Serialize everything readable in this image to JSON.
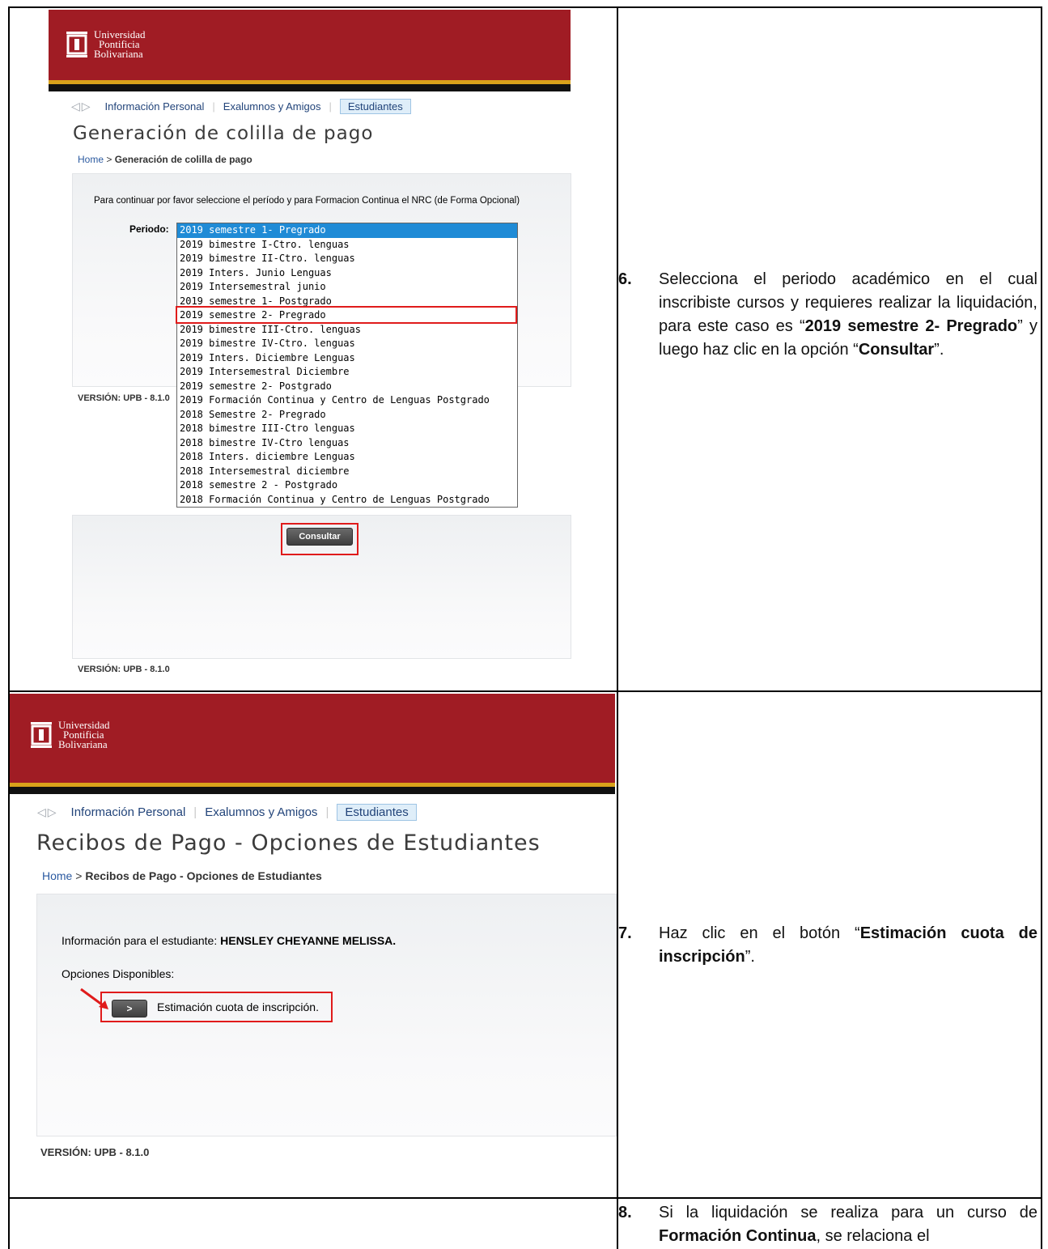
{
  "row1": {
    "brand": {
      "line1": "Universidad",
      "line2": "Pontificia",
      "line3": "Bolivariana"
    },
    "nav": {
      "tab1": "Información Personal",
      "tab2": "Exalumnos y Amigos",
      "tab3": "Estudiantes"
    },
    "page_title": "Generación de colilla de pago",
    "breadcrumb": {
      "home": "Home",
      "sep": ">",
      "current": "Generación de colilla de pago"
    },
    "instruction": "Para continuar por favor seleccione el período y para Formacion Continua el NRC (de Forma Opcional)",
    "periodo_label": "Periodo:",
    "periods": [
      "2019 semestre 1- Pregrado",
      "2019 bimestre I-Ctro. lenguas",
      "2019 bimestre II-Ctro. lenguas",
      "2019 Inters. Junio Lenguas",
      "2019 Intersemestral junio",
      "2019 semestre 1- Postgrado",
      "2019 semestre 2- Pregrado",
      "2019 bimestre III-Ctro. lenguas",
      "2019 bimestre IV-Ctro. lenguas",
      "2019 Inters. Diciembre Lenguas",
      "2019 Intersemestral Diciembre",
      "2019 semestre 2- Postgrado",
      "2019 Formación Continua y Centro de Lenguas Postgrado",
      "2018 Semestre 2- Pregrado",
      "2018 bimestre III-Ctro lenguas",
      "2018 bimestre IV-Ctro lenguas",
      "2018 Inters. diciembre Lenguas",
      "2018 Intersemestral diciembre",
      "2018 semestre 2 - Postgrado",
      "2018 Formación Continua y Centro de Lenguas Postgrado"
    ],
    "version_hidden": "VERSIÓN: UPB - 8.1.0",
    "consultar": "Consultar",
    "version": "VERSIÓN: UPB - 8.1.0",
    "step_num": "6.",
    "step_a": "Selecciona el periodo académico en el cual inscribiste cursos y requieres realizar la liquidación, para este caso es “",
    "step_b": "2019 semestre 2- Pregrado",
    "step_c": "” y luego haz clic en la opción “",
    "step_d": "Consultar",
    "step_e": "”."
  },
  "row2": {
    "brand": {
      "line1": "Universidad",
      "line2": "Pontificia",
      "line3": "Bolivariana"
    },
    "nav": {
      "tab1": "Información Personal",
      "tab2": "Exalumnos y Amigos",
      "tab3": "Estudiantes"
    },
    "page_title": "Recibos de Pago - Opciones de Estudiantes",
    "breadcrumb": {
      "home": "Home",
      "sep": ">",
      "current": "Recibos de Pago - Opciones de Estudiantes"
    },
    "info_prefix": "Información para el estudiante: ",
    "student": "HENSLEY CHEYANNE MELISSA.",
    "options_label": "Opciones Disponibles:",
    "arrow_btn": ">",
    "option": "Estimación cuota de inscripción.",
    "version": "VERSIÓN: UPB - 8.1.0",
    "step_num": "7.",
    "step_a": "Haz clic en el botón “",
    "step_b": "Estimación cuota de inscripción",
    "step_c": "”."
  },
  "row3": {
    "step_num": "8.",
    "step_a": "Si la liquidación se realiza para un curso de ",
    "step_b": "Formación Continua",
    "step_c": ", se relaciona el"
  },
  "colors": {
    "banner": "#a01c24",
    "highlight": "#e01b1b",
    "selected": "#1f8bd6"
  }
}
